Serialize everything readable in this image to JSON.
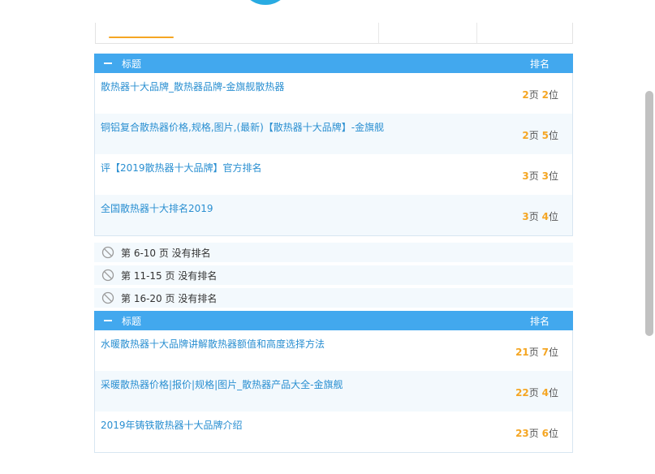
{
  "sections": [
    {
      "header": {
        "title": "标题",
        "rank": "排名"
      },
      "rows": [
        {
          "title": "散热器十大品牌_散热器品牌-金旗舰散热器",
          "page": "2",
          "page_unit": "页",
          "pos": "2",
          "pos_unit": "位"
        },
        {
          "title": "铜铝复合散热器价格,规格,图片,(最新)【散热器十大品牌】-金旗舰",
          "page": "2",
          "page_unit": "页",
          "pos": "5",
          "pos_unit": "位"
        },
        {
          "title": "评【2019散热器十大品牌】官方排名",
          "page": "3",
          "page_unit": "页",
          "pos": "3",
          "pos_unit": "位"
        },
        {
          "title": "全国散热器十大排名2019",
          "page": "3",
          "page_unit": "页",
          "pos": "4",
          "pos_unit": "位"
        }
      ]
    },
    {
      "header": {
        "title": "标题",
        "rank": "排名"
      },
      "rows": [
        {
          "title": "水暖散热器十大品牌讲解散热器额值和高度选择方法",
          "page": "21",
          "page_unit": "页",
          "pos": "7",
          "pos_unit": "位"
        },
        {
          "title": "采暖散热器价格|报价|规格|图片_散热器产品大全-金旗舰",
          "page": "22",
          "page_unit": "页",
          "pos": "4",
          "pos_unit": "位"
        },
        {
          "title": "2019年铸铁散热器十大品牌介绍",
          "page": "23",
          "page_unit": "页",
          "pos": "6",
          "pos_unit": "位"
        }
      ]
    }
  ],
  "no_rank": [
    {
      "label": "第 6-10 页 没有排名",
      "icon": "ban-icon"
    },
    {
      "label": "第 11-15 页 没有排名",
      "icon": "ban-icon"
    },
    {
      "label": "第 16-20 页 没有排名",
      "icon": "ban-icon"
    }
  ],
  "colors": {
    "header_bg": "#42a8ee",
    "link": "#2a8fd1",
    "rank_number": "#f5a623",
    "alt_row": "#f3f9fd"
  }
}
